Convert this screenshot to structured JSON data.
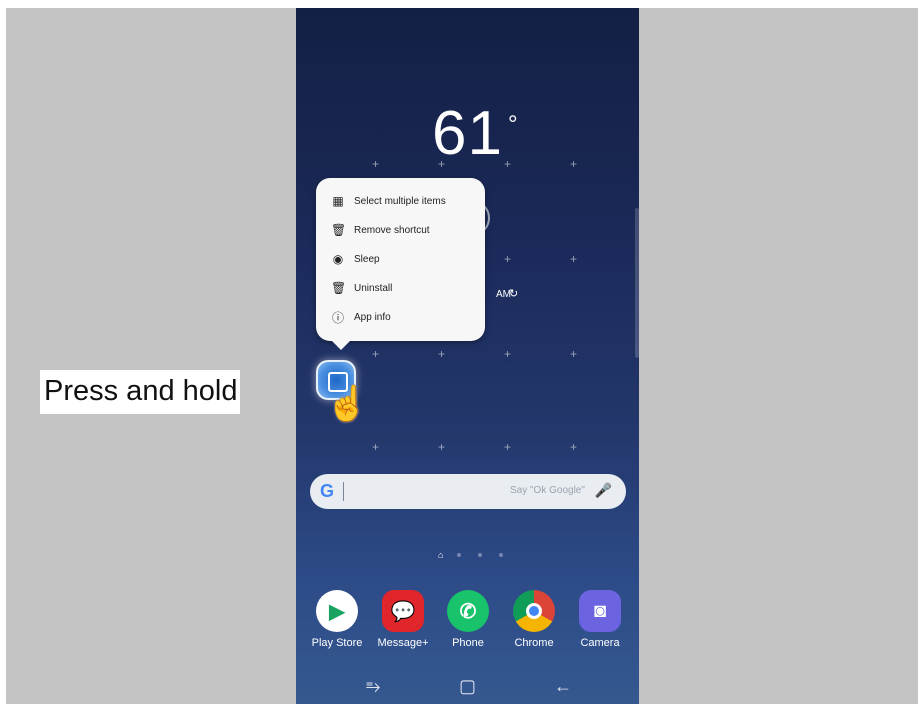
{
  "weather": {
    "temperature": "61",
    "degree_symbol": "°"
  },
  "context_menu": {
    "items": [
      {
        "icon": "select-multiple-icon",
        "glyph": "▦",
        "label": "Select multiple items"
      },
      {
        "icon": "trash-icon",
        "glyph": "🗑",
        "label": "Remove shortcut"
      },
      {
        "icon": "sleep-icon",
        "glyph": "◉",
        "label": "Sleep"
      },
      {
        "icon": "uninstall-icon",
        "glyph": "🗑",
        "label": "Uninstall"
      },
      {
        "icon": "info-icon",
        "glyph": "ⓘ",
        "label": "App info"
      }
    ]
  },
  "faint_texts": {
    "alarm": "AM"
  },
  "search": {
    "placeholder": "Say \"Ok Google\""
  },
  "dock": [
    {
      "label": "Play Store",
      "icon": "play-store-icon",
      "color": "#ffffff"
    },
    {
      "label": "Message+",
      "icon": "message-plus-icon",
      "color": "#e0252b"
    },
    {
      "label": "Phone",
      "icon": "phone-icon",
      "color": "#18c36b"
    },
    {
      "label": "Chrome",
      "icon": "chrome-icon",
      "color": "#ffffff"
    },
    {
      "label": "Camera",
      "icon": "camera-icon",
      "color": "#6b63e0"
    }
  ],
  "caption": "Press and hold"
}
